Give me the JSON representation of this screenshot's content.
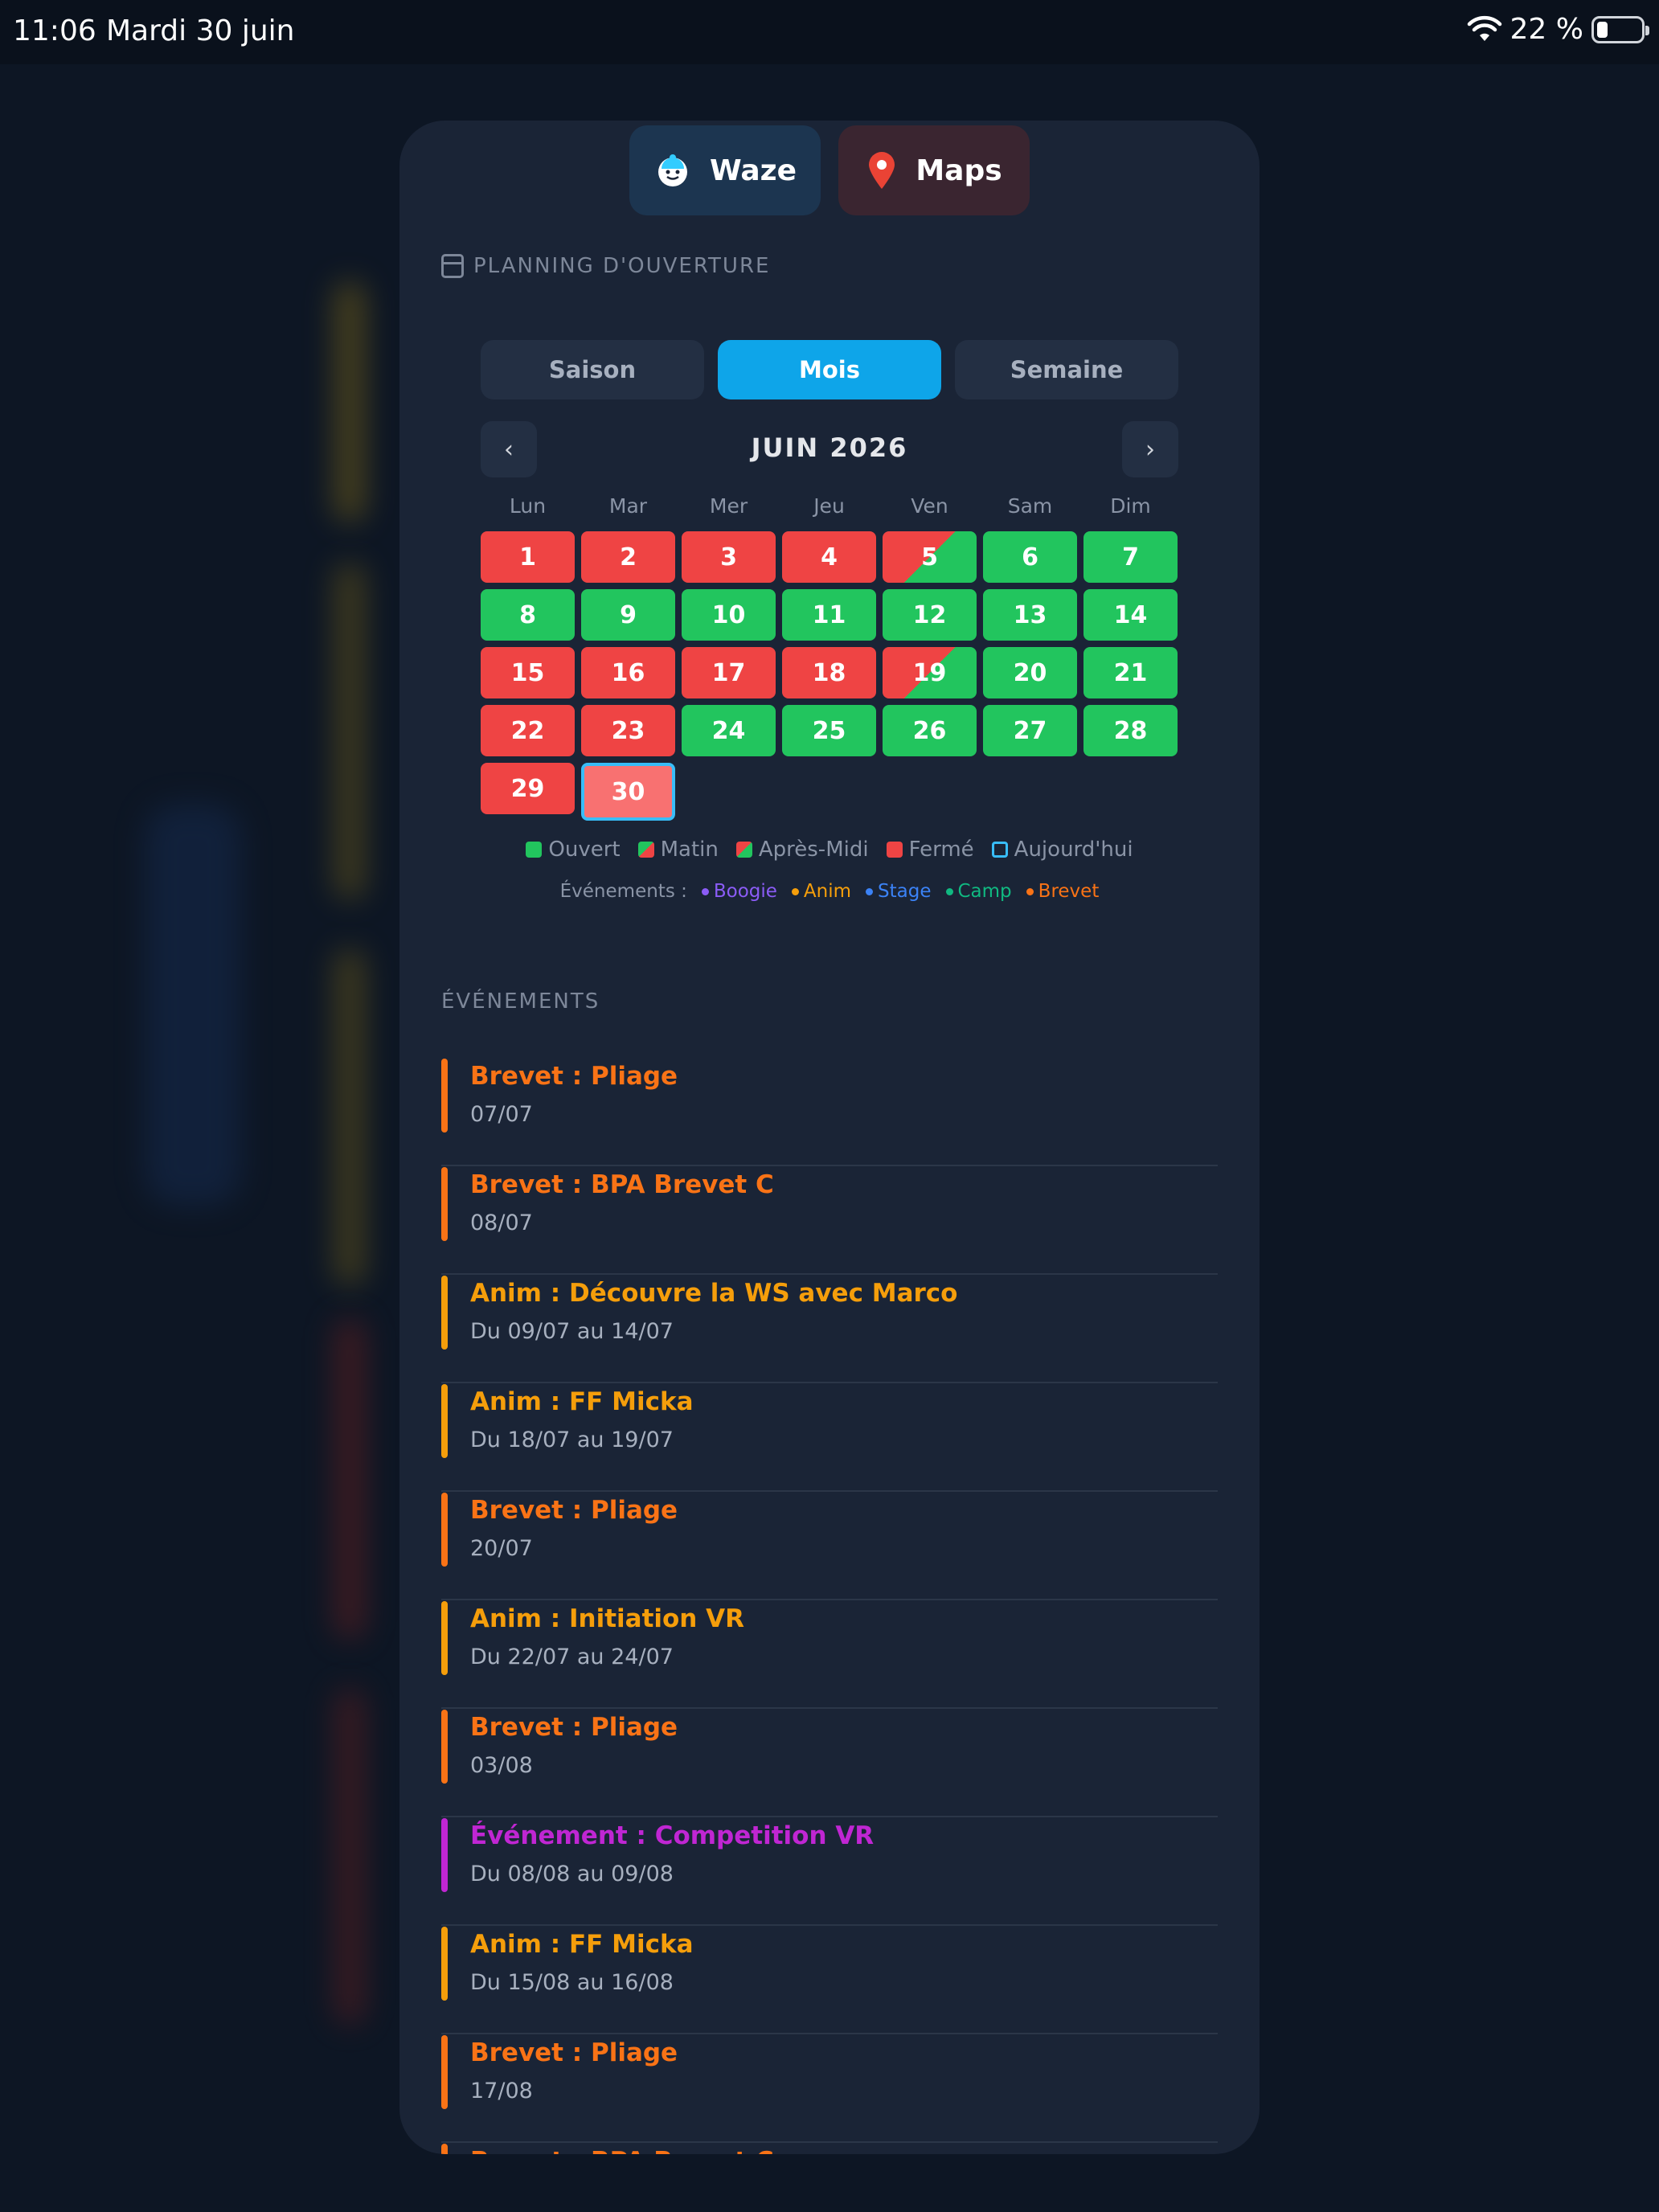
{
  "status_bar": {
    "time": "11:06",
    "date": "Mardi 30 juin",
    "battery": "22 %",
    "battery_level": 0.22
  },
  "nav_buttons": [
    {
      "label": "Waze",
      "icon": "waze-icon"
    },
    {
      "label": "Maps",
      "icon": "map-pin-icon"
    }
  ],
  "schedule": {
    "title": "PLANNING D'OUVERTURE",
    "view_tabs": [
      {
        "label": "Saison",
        "active": false
      },
      {
        "label": "Mois",
        "active": true
      },
      {
        "label": "Semaine",
        "active": false
      }
    ],
    "prev_label": "‹",
    "next_label": "›",
    "month_label": "JUIN 2026",
    "weekdays": [
      "Lun",
      "Mar",
      "Mer",
      "Jeu",
      "Ven",
      "Sam",
      "Dim"
    ],
    "days": [
      {
        "n": "1",
        "status": "closed"
      },
      {
        "n": "2",
        "status": "closed"
      },
      {
        "n": "3",
        "status": "closed"
      },
      {
        "n": "4",
        "status": "closed"
      },
      {
        "n": "5",
        "status": "morning"
      },
      {
        "n": "6",
        "status": "open"
      },
      {
        "n": "7",
        "status": "open"
      },
      {
        "n": "8",
        "status": "open"
      },
      {
        "n": "9",
        "status": "open"
      },
      {
        "n": "10",
        "status": "open"
      },
      {
        "n": "11",
        "status": "open"
      },
      {
        "n": "12",
        "status": "open"
      },
      {
        "n": "13",
        "status": "open"
      },
      {
        "n": "14",
        "status": "open"
      },
      {
        "n": "15",
        "status": "closed"
      },
      {
        "n": "16",
        "status": "closed"
      },
      {
        "n": "17",
        "status": "closed"
      },
      {
        "n": "18",
        "status": "closed"
      },
      {
        "n": "19",
        "status": "morning"
      },
      {
        "n": "20",
        "status": "open"
      },
      {
        "n": "21",
        "status": "open"
      },
      {
        "n": "22",
        "status": "closed"
      },
      {
        "n": "23",
        "status": "closed"
      },
      {
        "n": "24",
        "status": "open"
      },
      {
        "n": "25",
        "status": "open"
      },
      {
        "n": "26",
        "status": "open"
      },
      {
        "n": "27",
        "status": "open"
      },
      {
        "n": "28",
        "status": "open"
      },
      {
        "n": "29",
        "status": "closed"
      },
      {
        "n": "30",
        "status": "today"
      }
    ],
    "legend": [
      {
        "key": "open",
        "label": "Ouvert"
      },
      {
        "key": "morning",
        "label": "Matin"
      },
      {
        "key": "afternoon",
        "label": "Après-Midi"
      },
      {
        "key": "closed",
        "label": "Fermé"
      },
      {
        "key": "today",
        "label": "Aujourd'hui"
      }
    ],
    "events_legend_label": "Événements :",
    "event_types": [
      {
        "label": "Boogie",
        "color": "#8b5cf6"
      },
      {
        "label": "Anim",
        "color": "#f59e0b"
      },
      {
        "label": "Stage",
        "color": "#3b82f6"
      },
      {
        "label": "Camp",
        "color": "#10b981"
      },
      {
        "label": "Brevet",
        "color": "#f97316"
      }
    ]
  },
  "events": {
    "title": "ÉVÉNEMENTS",
    "items": [
      {
        "title": "Brevet : Pliage",
        "date": "07/07",
        "kind": "brevet"
      },
      {
        "title": "Brevet : BPA Brevet C",
        "date": "08/07",
        "kind": "brevet"
      },
      {
        "title": "Anim : Découvre la WS avec Marco",
        "date": "Du 09/07 au 14/07",
        "kind": "anim"
      },
      {
        "title": "Anim : FF Micka",
        "date": "Du 18/07 au 19/07",
        "kind": "anim"
      },
      {
        "title": "Brevet : Pliage",
        "date": "20/07",
        "kind": "brevet"
      },
      {
        "title": "Anim : Initiation VR",
        "date": "Du 22/07 au 24/07",
        "kind": "anim"
      },
      {
        "title": "Brevet : Pliage",
        "date": "03/08",
        "kind": "brevet"
      },
      {
        "title": "Événement : Competition VR",
        "date": "Du 08/08 au 09/08",
        "kind": "event"
      },
      {
        "title": "Anim : FF Micka",
        "date": "Du 15/08 au 16/08",
        "kind": "anim"
      },
      {
        "title": "Brevet : Pliage",
        "date": "17/08",
        "kind": "brevet"
      },
      {
        "title": "Brevet : BPA Brevet C",
        "date": "",
        "kind": "brevet"
      }
    ]
  }
}
